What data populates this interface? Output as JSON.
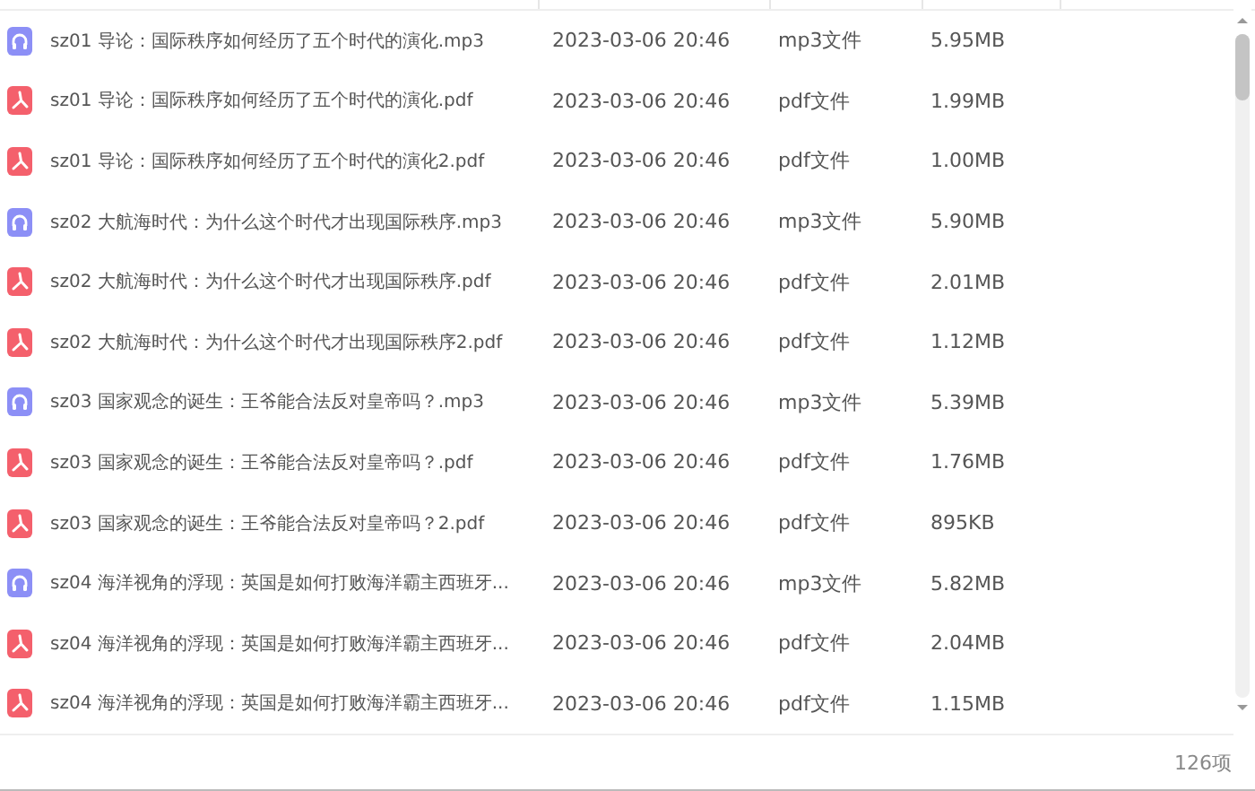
{
  "files": [
    {
      "kind": "audio",
      "name": "sz01  导论：国际秩序如何经历了五个时代的演化.mp3",
      "date": "2023-03-06 20:46",
      "type": "mp3文件",
      "size": "5.95MB"
    },
    {
      "kind": "pdf",
      "name": "sz01  导论：国际秩序如何经历了五个时代的演化.pdf",
      "date": "2023-03-06 20:46",
      "type": "pdf文件",
      "size": "1.99MB"
    },
    {
      "kind": "pdf",
      "name": "sz01  导论：国际秩序如何经历了五个时代的演化2.pdf",
      "date": "2023-03-06 20:46",
      "type": "pdf文件",
      "size": "1.00MB"
    },
    {
      "kind": "audio",
      "name": "sz02  大航海时代：为什么这个时代才出现国际秩序.mp3",
      "date": "2023-03-06 20:46",
      "type": "mp3文件",
      "size": "5.90MB"
    },
    {
      "kind": "pdf",
      "name": "sz02  大航海时代：为什么这个时代才出现国际秩序.pdf",
      "date": "2023-03-06 20:46",
      "type": "pdf文件",
      "size": "2.01MB"
    },
    {
      "kind": "pdf",
      "name": "sz02  大航海时代：为什么这个时代才出现国际秩序2.pdf",
      "date": "2023-03-06 20:46",
      "type": "pdf文件",
      "size": "1.12MB"
    },
    {
      "kind": "audio",
      "name": "sz03  国家观念的诞生：王爷能合法反对皇帝吗？.mp3",
      "date": "2023-03-06 20:46",
      "type": "mp3文件",
      "size": "5.39MB"
    },
    {
      "kind": "pdf",
      "name": "sz03  国家观念的诞生：王爷能合法反对皇帝吗？.pdf",
      "date": "2023-03-06 20:46",
      "type": "pdf文件",
      "size": "1.76MB"
    },
    {
      "kind": "pdf",
      "name": "sz03  国家观念的诞生：王爷能合法反对皇帝吗？2.pdf",
      "date": "2023-03-06 20:46",
      "type": "pdf文件",
      "size": "895KB"
    },
    {
      "kind": "audio",
      "name": "sz04  海洋视角的浮现：英国是如何打败海洋霸主西班牙...",
      "date": "2023-03-06 20:46",
      "type": "mp3文件",
      "size": "5.82MB"
    },
    {
      "kind": "pdf",
      "name": "sz04  海洋视角的浮现：英国是如何打败海洋霸主西班牙...",
      "date": "2023-03-06 20:46",
      "type": "pdf文件",
      "size": "2.04MB"
    },
    {
      "kind": "pdf",
      "name": "sz04  海洋视角的浮现：英国是如何打败海洋霸主西班牙...",
      "date": "2023-03-06 20:46",
      "type": "pdf文件",
      "size": "1.15MB"
    }
  ],
  "status_bar": {
    "count": "126项"
  }
}
